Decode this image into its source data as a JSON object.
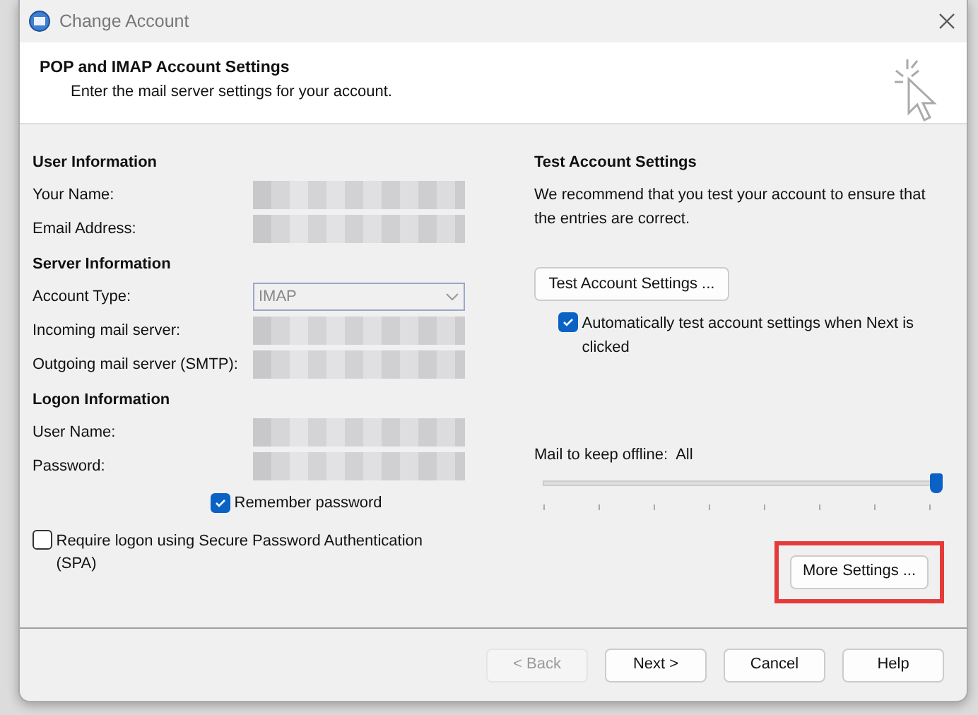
{
  "window": {
    "title": "Change Account"
  },
  "header": {
    "title": "POP and IMAP Account Settings",
    "subtitle": "Enter the mail server settings for your account."
  },
  "left_sections": [
    {
      "heading": "User Information",
      "rows": [
        {
          "label": "Your Name:",
          "kind": "text"
        },
        {
          "label": "Email Address:",
          "kind": "text"
        }
      ]
    },
    {
      "heading": "Server Information",
      "rows": [
        {
          "label": "Account Type:",
          "kind": "dropdown",
          "value": "IMAP",
          "disabled": true
        },
        {
          "label": "Incoming mail server:",
          "kind": "text"
        },
        {
          "label": "Outgoing mail server (SMTP):",
          "kind": "text"
        }
      ]
    },
    {
      "heading": "Logon Information",
      "rows": [
        {
          "label": "User Name:",
          "kind": "text"
        },
        {
          "label": "Password:",
          "kind": "text"
        }
      ]
    }
  ],
  "remember_password": {
    "label": "Remember password",
    "checked": true
  },
  "spa": {
    "label": "Require logon using Secure Password Authentication (SPA)",
    "checked": false
  },
  "test": {
    "heading": "Test Account Settings",
    "description": "We recommend that you test your account to ensure that the entries are correct.",
    "button": "Test Account Settings ...",
    "auto_test": {
      "label": "Automatically test account settings when Next is clicked",
      "checked": true
    }
  },
  "offline": {
    "label": "Mail to keep offline:",
    "value": "All",
    "level": 1
  },
  "more_settings": {
    "label": "More Settings ...",
    "highlighted": true
  },
  "footer_buttons": [
    {
      "label": "< Back",
      "disabled": true
    },
    {
      "label": "Next >",
      "disabled": false
    },
    {
      "label": "Cancel",
      "disabled": false
    },
    {
      "label": "Help",
      "disabled": false
    }
  ]
}
